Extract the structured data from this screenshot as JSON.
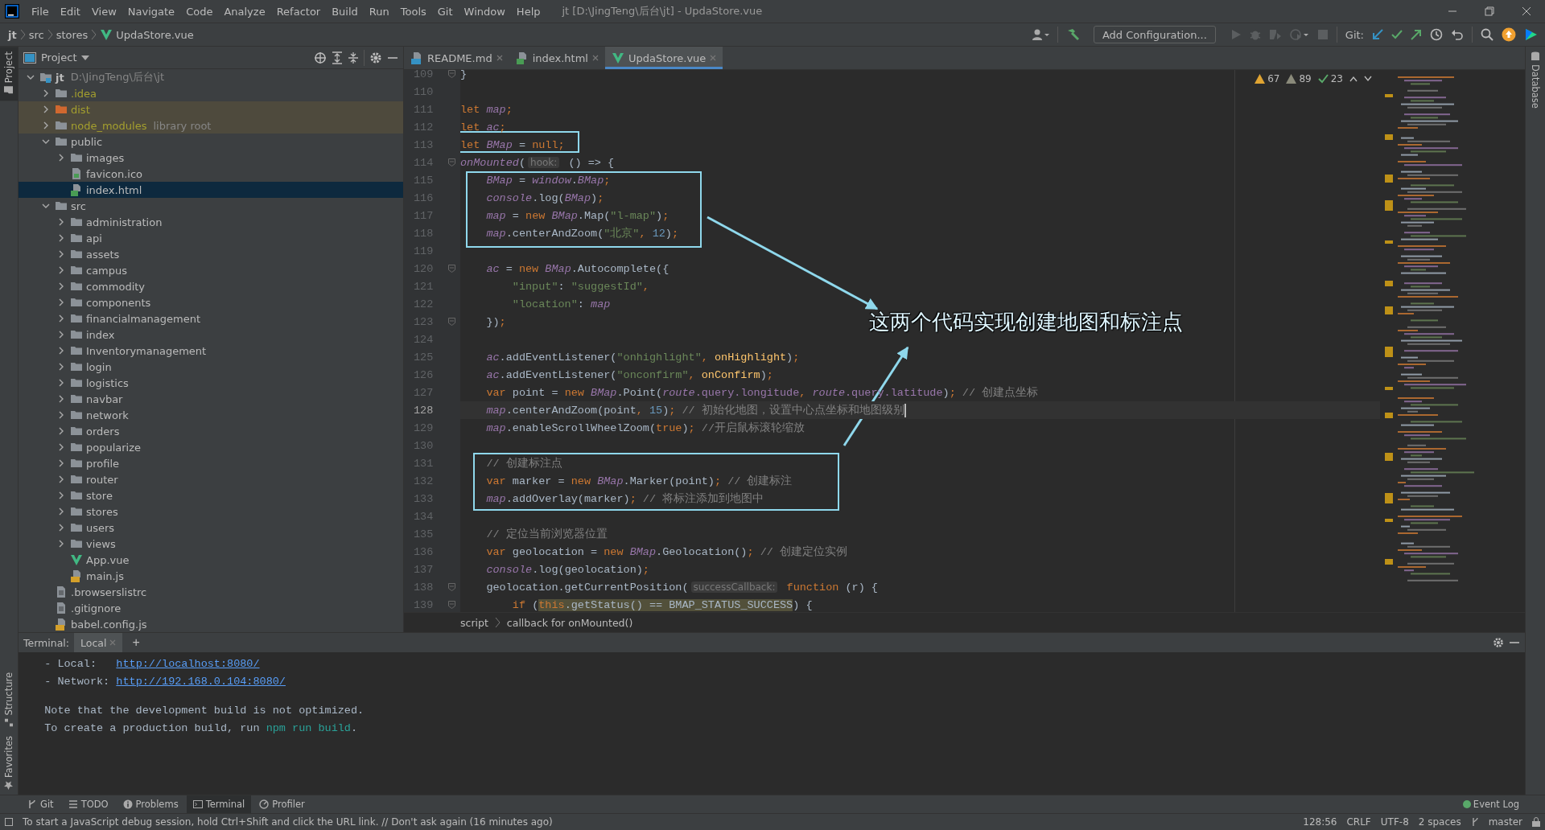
{
  "title_bar": {
    "menu": [
      "File",
      "Edit",
      "View",
      "Navigate",
      "Code",
      "Analyze",
      "Refactor",
      "Build",
      "Run",
      "Tools",
      "Git",
      "Window",
      "Help"
    ],
    "title": "jt [D:\\JingTeng\\后台\\jt] - UpdaStore.vue"
  },
  "nav_bar": {
    "breadcrumb": [
      "jt",
      "src",
      "stores",
      "UpdaStore.vue"
    ],
    "add_configuration": "Add Configuration...",
    "git_label": "Git:"
  },
  "tool_stripes": {
    "left": [
      "Project"
    ],
    "left_bottom": [
      "Structure",
      "Favorites"
    ],
    "right": [
      "Database"
    ]
  },
  "project": {
    "title": "Project",
    "tree": [
      {
        "name": "jt",
        "path": "D:\\JingTeng\\后台\\jt",
        "kind": "root",
        "expanded": true,
        "selected": false,
        "ignored": false,
        "highlighted": false,
        "children": [
          {
            "name": ".idea",
            "kind": "folder",
            "expanded": false,
            "selected": false,
            "ignored": true,
            "highlighted": false
          },
          {
            "name": "dist",
            "kind": "excluded-folder",
            "expanded": false,
            "selected": false,
            "ignored": true,
            "highlighted": true
          },
          {
            "name": "node_modules",
            "note": "library root",
            "kind": "folder",
            "expanded": false,
            "selected": false,
            "ignored": true,
            "highlighted": true
          },
          {
            "name": "public",
            "kind": "folder",
            "expanded": true,
            "selected": false,
            "ignored": false,
            "highlighted": false,
            "children": [
              {
                "name": "images",
                "kind": "folder",
                "expanded": false,
                "selected": false,
                "ignored": false,
                "highlighted": false
              },
              {
                "name": "favicon.ico",
                "kind": "ico",
                "selected": false,
                "ignored": false,
                "highlighted": false
              },
              {
                "name": "index.html",
                "kind": "html",
                "selected": true,
                "ignored": false,
                "highlighted": false
              }
            ]
          },
          {
            "name": "src",
            "kind": "folder",
            "expanded": true,
            "selected": false,
            "ignored": false,
            "highlighted": false,
            "children": [
              {
                "name": "administration",
                "kind": "folder",
                "expanded": false,
                "selected": false,
                "ignored": false,
                "highlighted": false
              },
              {
                "name": "api",
                "kind": "folder",
                "expanded": false,
                "selected": false,
                "ignored": false,
                "highlighted": false
              },
              {
                "name": "assets",
                "kind": "folder",
                "expanded": false,
                "selected": false,
                "ignored": false,
                "highlighted": false
              },
              {
                "name": "campus",
                "kind": "folder",
                "expanded": false,
                "selected": false,
                "ignored": false,
                "highlighted": false
              },
              {
                "name": "commodity",
                "kind": "folder",
                "expanded": false,
                "selected": false,
                "ignored": false,
                "highlighted": false
              },
              {
                "name": "components",
                "kind": "folder",
                "expanded": false,
                "selected": false,
                "ignored": false,
                "highlighted": false
              },
              {
                "name": "financialmanagement",
                "kind": "folder",
                "expanded": false,
                "selected": false,
                "ignored": false,
                "highlighted": false
              },
              {
                "name": "index",
                "kind": "folder",
                "expanded": false,
                "selected": false,
                "ignored": false,
                "highlighted": false
              },
              {
                "name": "Inventorymanagement",
                "kind": "folder",
                "expanded": false,
                "selected": false,
                "ignored": false,
                "highlighted": false
              },
              {
                "name": "login",
                "kind": "folder",
                "expanded": false,
                "selected": false,
                "ignored": false,
                "highlighted": false
              },
              {
                "name": "logistics",
                "kind": "folder",
                "expanded": false,
                "selected": false,
                "ignored": false,
                "highlighted": false
              },
              {
                "name": "navbar",
                "kind": "folder",
                "expanded": false,
                "selected": false,
                "ignored": false,
                "highlighted": false
              },
              {
                "name": "network",
                "kind": "folder",
                "expanded": false,
                "selected": false,
                "ignored": false,
                "highlighted": false
              },
              {
                "name": "orders",
                "kind": "folder",
                "expanded": false,
                "selected": false,
                "ignored": false,
                "highlighted": false
              },
              {
                "name": "popularize",
                "kind": "folder",
                "expanded": false,
                "selected": false,
                "ignored": false,
                "highlighted": false
              },
              {
                "name": "profile",
                "kind": "folder",
                "expanded": false,
                "selected": false,
                "ignored": false,
                "highlighted": false
              },
              {
                "name": "router",
                "kind": "folder",
                "expanded": false,
                "selected": false,
                "ignored": false,
                "highlighted": false
              },
              {
                "name": "store",
                "kind": "folder",
                "expanded": false,
                "selected": false,
                "ignored": false,
                "highlighted": false
              },
              {
                "name": "stores",
                "kind": "folder",
                "expanded": false,
                "selected": false,
                "ignored": false,
                "highlighted": false
              },
              {
                "name": "users",
                "kind": "folder",
                "expanded": false,
                "selected": false,
                "ignored": false,
                "highlighted": false
              },
              {
                "name": "views",
                "kind": "folder",
                "expanded": false,
                "selected": false,
                "ignored": false,
                "highlighted": false
              },
              {
                "name": "App.vue",
                "kind": "vue",
                "selected": false,
                "ignored": false,
                "highlighted": false
              },
              {
                "name": "main.js",
                "kind": "js",
                "selected": false,
                "ignored": false,
                "highlighted": false
              }
            ]
          },
          {
            "name": ".browserslistrc",
            "kind": "text",
            "selected": false,
            "ignored": false,
            "highlighted": false
          },
          {
            "name": ".gitignore",
            "kind": "text",
            "selected": false,
            "ignored": false,
            "highlighted": false
          },
          {
            "name": "babel.config.js",
            "kind": "js",
            "selected": false,
            "ignored": false,
            "highlighted": false
          }
        ]
      }
    ]
  },
  "editor": {
    "tabs": [
      {
        "label": "README.md",
        "kind": "md",
        "selected": false
      },
      {
        "label": "index.html",
        "kind": "html",
        "selected": false
      },
      {
        "label": "UpdaStore.vue",
        "kind": "vue",
        "selected": true
      }
    ],
    "inspections": [
      {
        "kind": "warning",
        "count": "67"
      },
      {
        "kind": "weak",
        "count": "89"
      },
      {
        "kind": "typo",
        "count": "23"
      }
    ],
    "lines": [
      {
        "number": "109",
        "fold": true,
        "current": false,
        "tokens": [
          {
            "kind": "pl",
            "text": "}"
          }
        ]
      },
      {
        "number": "110",
        "fold": false,
        "current": false
      },
      {
        "number": "111",
        "fold": false,
        "current": false,
        "tokens": [
          {
            "kind": "kw",
            "text": "let "
          },
          {
            "kind": "var",
            "text": "map"
          },
          {
            "kind": "kw",
            "text": ";"
          }
        ]
      },
      {
        "number": "112",
        "fold": false,
        "current": false,
        "tokens": [
          {
            "kind": "kw",
            "text": "let "
          },
          {
            "kind": "var",
            "text": "ac"
          },
          {
            "kind": "kw",
            "text": ";"
          }
        ]
      },
      {
        "number": "113",
        "fold": false,
        "current": false,
        "tokens": [
          {
            "kind": "kw",
            "text": "let "
          },
          {
            "kind": "var",
            "text": "BMap"
          },
          {
            "kind": "pl",
            "text": " = "
          },
          {
            "kind": "kw",
            "text": "null;"
          }
        ]
      },
      {
        "number": "114",
        "fold": true,
        "current": false,
        "tokens": [
          {
            "kind": "var",
            "text": "onMounted"
          },
          {
            "kind": "pl",
            "text": "("
          },
          {
            "kind": "hint",
            "text": "hook:"
          },
          {
            "kind": "pl",
            "text": " () => {"
          }
        ]
      },
      {
        "number": "115",
        "fold": false,
        "current": false,
        "tokens": [
          {
            "kind": "var",
            "text": "    BMap"
          },
          {
            "kind": "pl",
            "text": " = "
          },
          {
            "kind": "var",
            "text": "window"
          },
          {
            "kind": "pl",
            "text": "."
          },
          {
            "kind": "var",
            "text": "BMap"
          },
          {
            "kind": "kw",
            "text": ";"
          }
        ]
      },
      {
        "number": "116",
        "fold": false,
        "current": false,
        "tokens": [
          {
            "kind": "var",
            "text": "    console"
          },
          {
            "kind": "pl",
            "text": ".log("
          },
          {
            "kind": "var",
            "text": "BMap"
          },
          {
            "kind": "pl",
            "text": ")"
          },
          {
            "kind": "kw",
            "text": ";"
          }
        ]
      },
      {
        "number": "117",
        "fold": false,
        "current": false,
        "tokens": [
          {
            "kind": "var",
            "text": "    map"
          },
          {
            "kind": "pl",
            "text": " = "
          },
          {
            "kind": "kw",
            "text": "new "
          },
          {
            "kind": "var",
            "text": "BMap"
          },
          {
            "kind": "pl",
            "text": ".Map("
          },
          {
            "kind": "str",
            "text": "\"l-map\""
          },
          {
            "kind": "pl",
            "text": ")"
          },
          {
            "kind": "kw",
            "text": ";"
          }
        ]
      },
      {
        "number": "118",
        "fold": false,
        "current": false,
        "tokens": [
          {
            "kind": "var",
            "text": "    map"
          },
          {
            "kind": "pl",
            "text": ".centerAndZoom("
          },
          {
            "kind": "str",
            "text": "\"北京\""
          },
          {
            "kind": "kw",
            "text": ", "
          },
          {
            "kind": "num",
            "text": "12"
          },
          {
            "kind": "pl",
            "text": ")"
          },
          {
            "kind": "kw",
            "text": ";"
          }
        ]
      },
      {
        "number": "119",
        "fold": false,
        "current": false
      },
      {
        "number": "120",
        "fold": true,
        "current": false,
        "tokens": [
          {
            "kind": "var",
            "text": "    ac"
          },
          {
            "kind": "pl",
            "text": " = "
          },
          {
            "kind": "kw",
            "text": "new "
          },
          {
            "kind": "var",
            "text": "BMap"
          },
          {
            "kind": "pl",
            "text": ".Autocomplete({"
          }
        ]
      },
      {
        "number": "121",
        "fold": false,
        "current": false,
        "tokens": [
          {
            "kind": "str",
            "text": "        \"input\""
          },
          {
            "kind": "pl",
            "text": ": "
          },
          {
            "kind": "str",
            "text": "\"suggestId\""
          },
          {
            "kind": "kw",
            "text": ","
          }
        ]
      },
      {
        "number": "122",
        "fold": false,
        "current": false,
        "tokens": [
          {
            "kind": "str",
            "text": "        \"location\""
          },
          {
            "kind": "pl",
            "text": ": "
          },
          {
            "kind": "var",
            "text": "map"
          }
        ]
      },
      {
        "number": "123",
        "fold": true,
        "current": false,
        "tokens": [
          {
            "kind": "pl",
            "text": "    })"
          },
          {
            "kind": "kw",
            "text": ";"
          }
        ]
      },
      {
        "number": "124",
        "fold": false,
        "current": false
      },
      {
        "number": "125",
        "fold": false,
        "current": false,
        "tokens": [
          {
            "kind": "var",
            "text": "    ac"
          },
          {
            "kind": "pl",
            "text": ".addEventListener("
          },
          {
            "kind": "str",
            "text": "\"onhighlight\""
          },
          {
            "kind": "kw",
            "text": ", "
          },
          {
            "kind": "fn",
            "text": "onHighlight"
          },
          {
            "kind": "pl",
            "text": ")"
          },
          {
            "kind": "kw",
            "text": ";"
          }
        ]
      },
      {
        "number": "126",
        "fold": false,
        "current": false,
        "tokens": [
          {
            "kind": "var",
            "text": "    ac"
          },
          {
            "kind": "pl",
            "text": ".addEventListener("
          },
          {
            "kind": "str",
            "text": "\"onconfirm\""
          },
          {
            "kind": "kw",
            "text": ", "
          },
          {
            "kind": "fn",
            "text": "onConfirm"
          },
          {
            "kind": "pl",
            "text": ")"
          },
          {
            "kind": "kw",
            "text": ";"
          }
        ]
      },
      {
        "number": "127",
        "fold": false,
        "current": false,
        "tokens": [
          {
            "kind": "kw",
            "text": "    var "
          },
          {
            "kind": "pl",
            "text": "point = "
          },
          {
            "kind": "kw",
            "text": "new "
          },
          {
            "kind": "var",
            "text": "BMap"
          },
          {
            "kind": "pl",
            "text": ".Point("
          },
          {
            "kind": "var",
            "text": "route"
          },
          {
            "kind": "mem",
            "text": ".query.longitude"
          },
          {
            "kind": "kw",
            "text": ", "
          },
          {
            "kind": "var",
            "text": "route"
          },
          {
            "kind": "mem",
            "text": ".query.latitude"
          },
          {
            "kind": "pl",
            "text": ")"
          },
          {
            "kind": "kw",
            "text": "; "
          },
          {
            "kind": "com",
            "text": "// 创建点坐标"
          }
        ]
      },
      {
        "number": "128",
        "fold": false,
        "current": true,
        "tokens": [
          {
            "kind": "var",
            "text": "    map"
          },
          {
            "kind": "pl",
            "text": ".centerAndZoom(point"
          },
          {
            "kind": "kw",
            "text": ", "
          },
          {
            "kind": "num",
            "text": "15"
          },
          {
            "kind": "pl",
            "text": ")"
          },
          {
            "kind": "kw",
            "text": "; "
          },
          {
            "kind": "com",
            "text": "// 初始化地图，设置中心点坐标和地图级别"
          }
        ]
      },
      {
        "number": "129",
        "fold": false,
        "current": false,
        "tokens": [
          {
            "kind": "var",
            "text": "    map"
          },
          {
            "kind": "pl",
            "text": ".enableScrollWheelZoom("
          },
          {
            "kind": "kw",
            "text": "true"
          },
          {
            "kind": "pl",
            "text": ")"
          },
          {
            "kind": "kw",
            "text": "; "
          },
          {
            "kind": "com",
            "text": "//开启鼠标滚轮缩放"
          }
        ]
      },
      {
        "number": "130",
        "fold": false,
        "current": false
      },
      {
        "number": "131",
        "fold": false,
        "current": false,
        "tokens": [
          {
            "kind": "com",
            "text": "    // 创建标注点"
          }
        ]
      },
      {
        "number": "132",
        "fold": false,
        "current": false,
        "tokens": [
          {
            "kind": "kw",
            "text": "    var "
          },
          {
            "kind": "pl",
            "text": "marker = "
          },
          {
            "kind": "kw",
            "text": "new "
          },
          {
            "kind": "var",
            "text": "BMap"
          },
          {
            "kind": "pl",
            "text": ".Marker(point)"
          },
          {
            "kind": "kw",
            "text": "; "
          },
          {
            "kind": "com",
            "text": "// 创建标注"
          }
        ]
      },
      {
        "number": "133",
        "fold": false,
        "current": false,
        "tokens": [
          {
            "kind": "var",
            "text": "    map"
          },
          {
            "kind": "pl",
            "text": ".addOverlay(marker)"
          },
          {
            "kind": "kw",
            "text": "; "
          },
          {
            "kind": "com",
            "text": "// 将标注添加到地图中"
          }
        ]
      },
      {
        "number": "134",
        "fold": false,
        "current": false
      },
      {
        "number": "135",
        "fold": false,
        "current": false,
        "tokens": [
          {
            "kind": "com",
            "text": "    // 定位当前浏览器位置"
          }
        ]
      },
      {
        "number": "136",
        "fold": false,
        "current": false,
        "tokens": [
          {
            "kind": "kw",
            "text": "    var "
          },
          {
            "kind": "pl",
            "text": "geolocation = "
          },
          {
            "kind": "kw",
            "text": "new "
          },
          {
            "kind": "var",
            "text": "BMap"
          },
          {
            "kind": "pl",
            "text": ".Geolocation()"
          },
          {
            "kind": "kw",
            "text": "; "
          },
          {
            "kind": "com",
            "text": "// 创建定位实例"
          }
        ]
      },
      {
        "number": "137",
        "fold": false,
        "current": false,
        "tokens": [
          {
            "kind": "var",
            "text": "    console"
          },
          {
            "kind": "pl",
            "text": ".log(geolocation)"
          },
          {
            "kind": "kw",
            "text": ";"
          }
        ]
      },
      {
        "number": "138",
        "fold": true,
        "current": false,
        "tokens": [
          {
            "kind": "pl",
            "text": "    geolocation.getCurrentPosition("
          },
          {
            "kind": "hint",
            "text": "successCallback:"
          },
          {
            "kind": "kw",
            "text": " function "
          },
          {
            "kind": "pl",
            "text": "(r) {"
          }
        ]
      },
      {
        "number": "139",
        "fold": true,
        "current": false,
        "tokens": [
          {
            "kind": "kw",
            "text": "        if "
          },
          {
            "kind": "pl",
            "text": "("
          },
          {
            "kind": "hlk",
            "text": "this"
          },
          {
            "kind": "hl",
            "text": ".getStatus() == BMAP_STATUS_SUCCESS"
          },
          {
            "kind": "pl",
            "text": ") {"
          }
        ]
      }
    ],
    "annotation": "这两个代码实现创建地图和标注点",
    "breadcrumb": [
      "script",
      "callback for onMounted()"
    ]
  },
  "terminal": {
    "label": "Terminal:",
    "tabs": [
      {
        "label": "Local",
        "selected": true
      }
    ],
    "add": "+",
    "lines": [
      {
        "kind": "text",
        "tokens": [
          {
            "kind": "pl",
            "text": "  - Local:   "
          },
          {
            "kind": "link",
            "text": "http://localhost:8080/"
          }
        ]
      },
      {
        "kind": "text",
        "tokens": [
          {
            "kind": "pl",
            "text": "  - Network: "
          },
          {
            "kind": "link",
            "text": "http://192.168.0.104:8080/"
          }
        ]
      },
      {
        "kind": "blank"
      },
      {
        "kind": "text",
        "tokens": [
          {
            "kind": "pl",
            "text": "  Note that the development build is not optimized."
          }
        ]
      },
      {
        "kind": "text",
        "tokens": [
          {
            "kind": "pl",
            "text": "  To create a production build, run "
          },
          {
            "kind": "cmd",
            "text": "npm run build"
          },
          {
            "kind": "pl",
            "text": "."
          }
        ]
      }
    ]
  },
  "bottom_tabs": [
    {
      "label": "Git",
      "kind": "git",
      "selected": false
    },
    {
      "label": "TODO",
      "kind": "todo",
      "selected": false
    },
    {
      "label": "Problems",
      "kind": "problems",
      "selected": false
    },
    {
      "label": "Terminal",
      "kind": "terminal",
      "selected": true
    },
    {
      "label": "Profiler",
      "kind": "profiler",
      "selected": false
    }
  ],
  "status_bar": {
    "message": "To start a JavaScript debug session, hold Ctrl+Shift and click the URL link. // Don't ask again (16 minutes ago)",
    "event_log": "Event Log",
    "items": [
      "128:56",
      "CRLF",
      "UTF-8",
      "2 spaces",
      "master"
    ]
  }
}
